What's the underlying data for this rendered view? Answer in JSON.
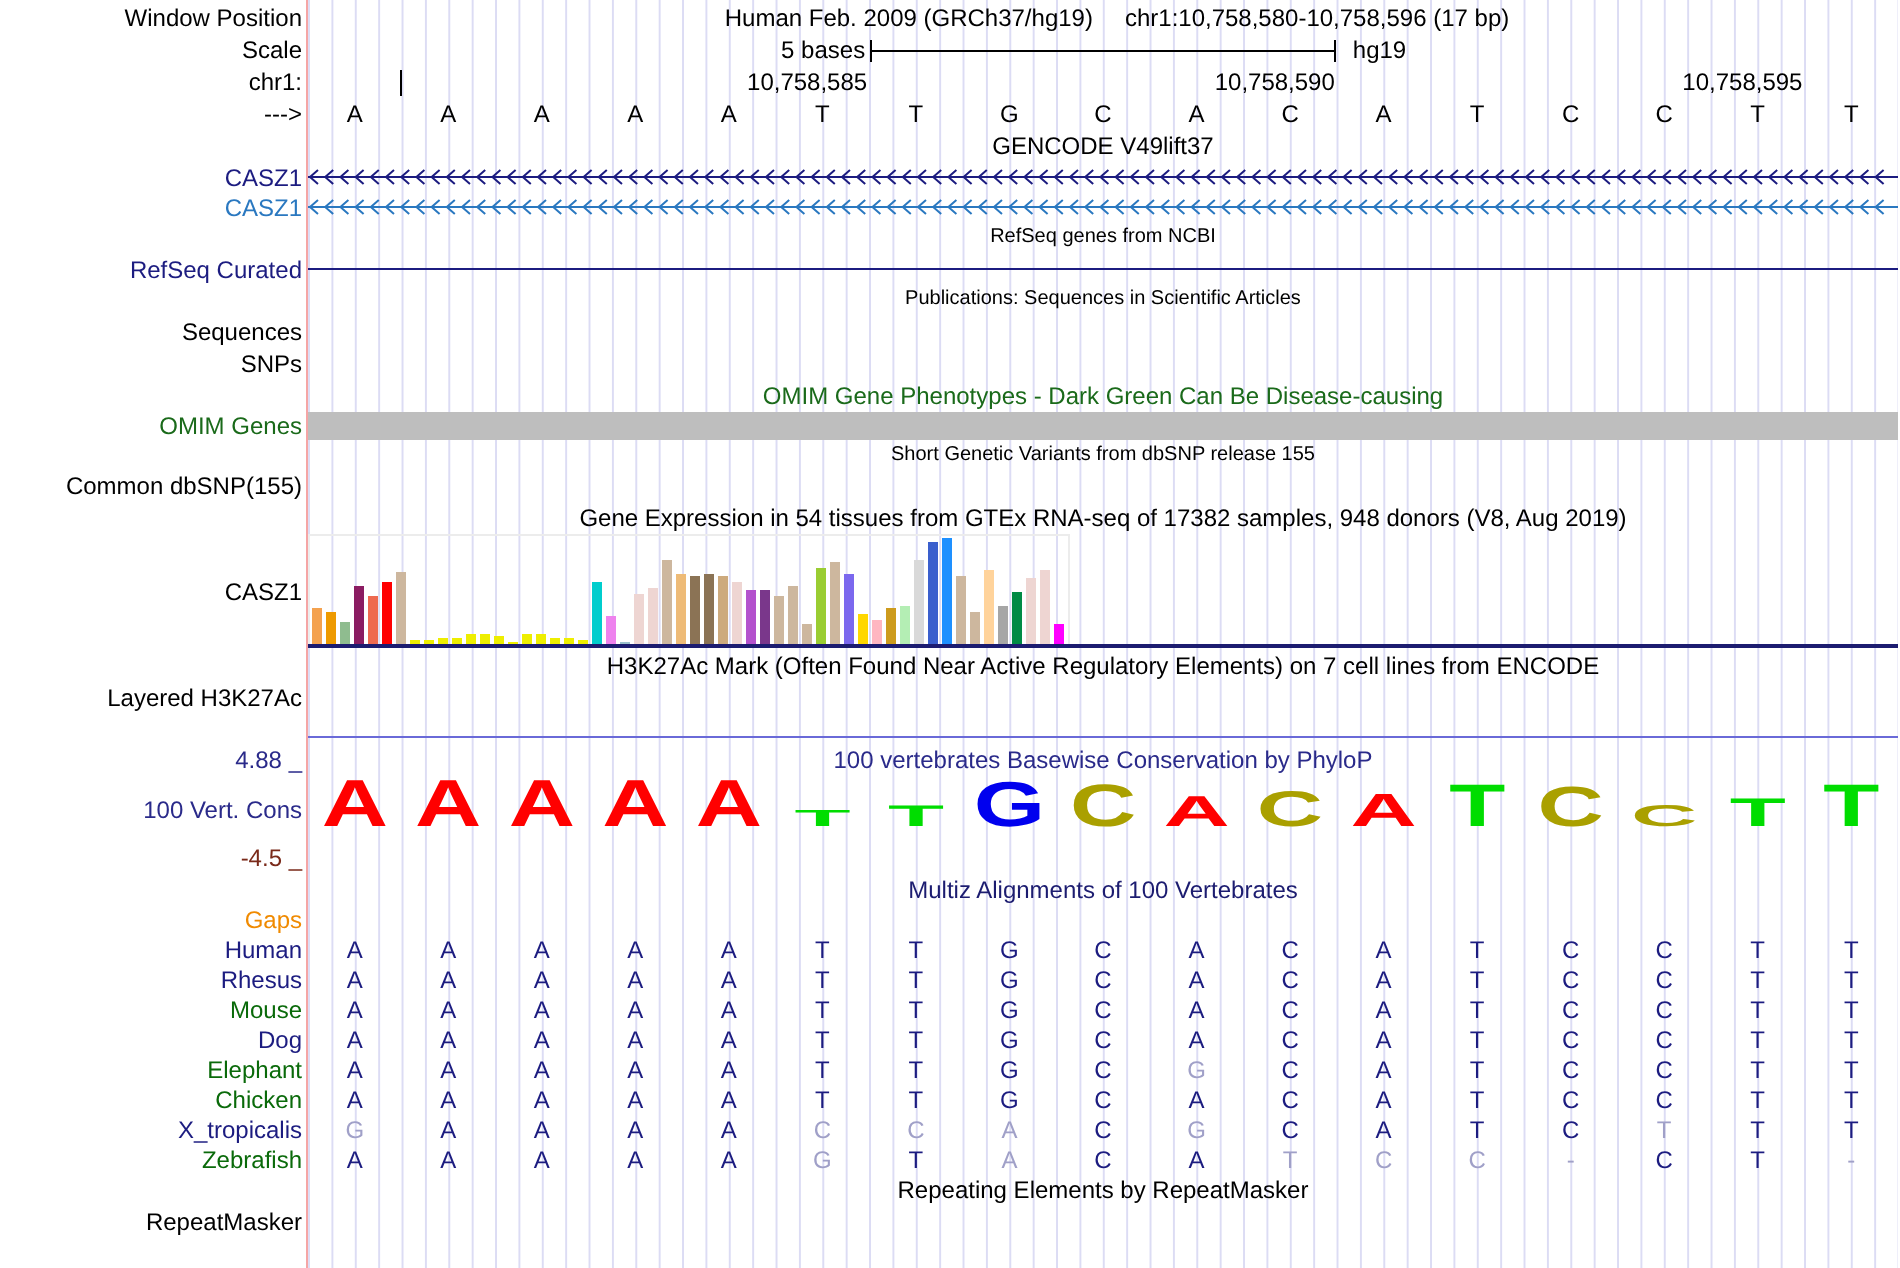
{
  "header": {
    "position_label": "Window Position",
    "assembly": "Human Feb. 2009 (GRCh37/hg19)",
    "range": "chr1:10,758,580-10,758,596 (17 bp)",
    "scale_label": "Scale",
    "scale_text": "5 bases",
    "scale_assembly": "hg19",
    "ruler_label": "chr1:",
    "bases_label": "--->"
  },
  "ruler_labels": [
    "10,758,585",
    "10,758,590",
    "10,758,595"
  ],
  "reference_bases": [
    "A",
    "A",
    "A",
    "A",
    "A",
    "T",
    "T",
    "G",
    "C",
    "A",
    "C",
    "A",
    "T",
    "C",
    "C",
    "T",
    "T"
  ],
  "gencode": {
    "title": "GENCODE V49lift37",
    "genes": [
      {
        "name": "CASZ1",
        "color": "#1c1c80"
      },
      {
        "name": "CASZ1",
        "color": "#2a78c0"
      }
    ]
  },
  "refseq": {
    "title": "RefSeq genes from NCBI",
    "label": "RefSeq Curated"
  },
  "publications": {
    "title": "Publications: Sequences in Scientific Articles",
    "rows": [
      "Sequences",
      "SNPs"
    ]
  },
  "omim": {
    "title": "OMIM Gene Phenotypes - Dark Green Can Be Disease-causing",
    "label": "OMIM Genes"
  },
  "dbsnp": {
    "title": "Short Genetic Variants from dbSNP release 155",
    "label": "Common dbSNP(155)"
  },
  "gtex": {
    "title": "Gene Expression in 54 tissues from GTEx RNA-seq of 17382 samples, 948 donors (V8, Aug 2019)",
    "label": "CASZ1"
  },
  "h3k27ac": {
    "title": "H3K27Ac Mark (Often Found Near Active Regulatory Elements) on 7 cell lines from ENCODE",
    "label": "Layered H3K27Ac"
  },
  "conservation": {
    "title": "100 vertebrates Basewise Conservation by PhyloP",
    "max_label": "4.88 _",
    "label": "100 Vert. Cons",
    "min_label": "-4.5 _",
    "logo": [
      {
        "base": "A",
        "color": "#ff0000"
      },
      {
        "base": "A",
        "color": "#ff0000"
      },
      {
        "base": "A",
        "color": "#ff0000"
      },
      {
        "base": "A",
        "color": "#ff0000"
      },
      {
        "base": "A",
        "color": "#ff0000"
      },
      {
        "base": "T",
        "color": "#00dd00"
      },
      {
        "base": "T",
        "color": "#00dd00"
      },
      {
        "base": "G",
        "color": "#0000ee"
      },
      {
        "base": "C",
        "color": "#aaa000"
      },
      {
        "base": "A",
        "color": "#ff0000"
      },
      {
        "base": "C",
        "color": "#aaa000"
      },
      {
        "base": "A",
        "color": "#ff0000"
      },
      {
        "base": "T",
        "color": "#00dd00"
      },
      {
        "base": "C",
        "color": "#aaa000"
      },
      {
        "base": "C",
        "color": "#aaa000"
      },
      {
        "base": "T",
        "color": "#00dd00"
      },
      {
        "base": "T",
        "color": "#00dd00"
      }
    ]
  },
  "multiz": {
    "title": "Multiz Alignments of 100 Vertebrates",
    "gaps_label": "Gaps",
    "species": [
      {
        "name": "Human",
        "color": "#1c1c80",
        "bases": [
          "A",
          "A",
          "A",
          "A",
          "A",
          "T",
          "T",
          "G",
          "C",
          "A",
          "C",
          "A",
          "T",
          "C",
          "C",
          "T",
          "T"
        ],
        "faded": [
          false,
          false,
          false,
          false,
          false,
          false,
          false,
          false,
          false,
          false,
          false,
          false,
          false,
          false,
          false,
          false,
          false
        ]
      },
      {
        "name": "Rhesus",
        "color": "#1c1c80",
        "bases": [
          "A",
          "A",
          "A",
          "A",
          "A",
          "T",
          "T",
          "G",
          "C",
          "A",
          "C",
          "A",
          "T",
          "C",
          "C",
          "T",
          "T"
        ],
        "faded": [
          false,
          false,
          false,
          false,
          false,
          false,
          false,
          false,
          false,
          false,
          false,
          false,
          false,
          false,
          false,
          false,
          false
        ]
      },
      {
        "name": "Mouse",
        "color": "#0a6a0a",
        "bases": [
          "A",
          "A",
          "A",
          "A",
          "A",
          "T",
          "T",
          "G",
          "C",
          "A",
          "C",
          "A",
          "T",
          "C",
          "C",
          "T",
          "T"
        ],
        "faded": [
          false,
          false,
          false,
          false,
          false,
          false,
          false,
          false,
          false,
          false,
          false,
          false,
          false,
          false,
          false,
          false,
          false
        ]
      },
      {
        "name": "Dog",
        "color": "#1c1c80",
        "bases": [
          "A",
          "A",
          "A",
          "A",
          "A",
          "T",
          "T",
          "G",
          "C",
          "A",
          "C",
          "A",
          "T",
          "C",
          "C",
          "T",
          "T"
        ],
        "faded": [
          false,
          false,
          false,
          false,
          false,
          false,
          false,
          false,
          false,
          false,
          false,
          false,
          false,
          false,
          false,
          false,
          false
        ]
      },
      {
        "name": "Elephant",
        "color": "#0a6a0a",
        "bases": [
          "A",
          "A",
          "A",
          "A",
          "A",
          "T",
          "T",
          "G",
          "C",
          "G",
          "C",
          "A",
          "T",
          "C",
          "C",
          "T",
          "T"
        ],
        "faded": [
          false,
          false,
          false,
          false,
          false,
          false,
          false,
          false,
          false,
          true,
          false,
          false,
          false,
          false,
          false,
          false,
          false
        ]
      },
      {
        "name": "Chicken",
        "color": "#0a6a0a",
        "bases": [
          "A",
          "A",
          "A",
          "A",
          "A",
          "T",
          "T",
          "G",
          "C",
          "A",
          "C",
          "A",
          "T",
          "C",
          "C",
          "T",
          "T"
        ],
        "faded": [
          false,
          false,
          false,
          false,
          false,
          false,
          false,
          false,
          false,
          false,
          false,
          false,
          false,
          false,
          false,
          false,
          false
        ]
      },
      {
        "name": "X_tropicalis",
        "color": "#1c1c80",
        "bases": [
          "G",
          "A",
          "A",
          "A",
          "A",
          "C",
          "C",
          "A",
          "C",
          "G",
          "C",
          "A",
          "T",
          "C",
          "T",
          "T",
          "T"
        ],
        "faded": [
          true,
          false,
          false,
          false,
          false,
          true,
          true,
          true,
          false,
          true,
          false,
          false,
          false,
          false,
          true,
          false,
          false
        ]
      },
      {
        "name": "Zebrafish",
        "color": "#0a6a0a",
        "bases": [
          "A",
          "A",
          "A",
          "A",
          "A",
          "G",
          "T",
          "A",
          "C",
          "A",
          "T",
          "C",
          "C",
          "-",
          "C",
          "T",
          "-"
        ],
        "faded": [
          false,
          false,
          false,
          false,
          false,
          true,
          false,
          true,
          false,
          false,
          true,
          true,
          true,
          true,
          false,
          false,
          true
        ]
      }
    ]
  },
  "repeatmasker": {
    "title": "Repeating Elements by RepeatMasker",
    "label": "RepeatMasker"
  }
}
